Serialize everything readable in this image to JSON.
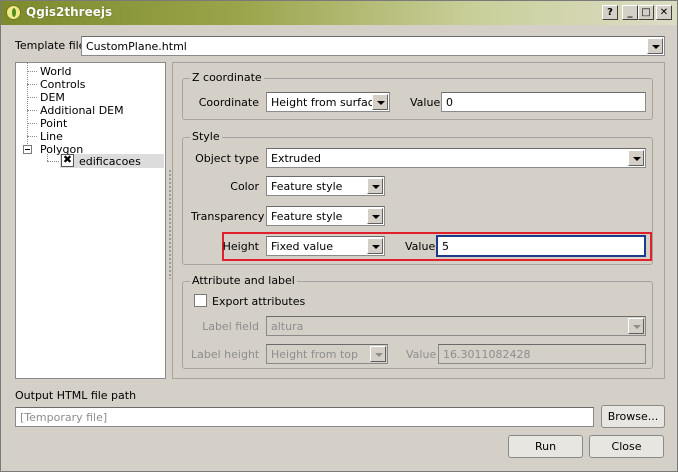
{
  "window": {
    "title": "Qgis2threejs"
  },
  "titlebar_buttons": {
    "help": "?",
    "minimize": "_",
    "maximize": "□",
    "close": "✕"
  },
  "template": {
    "label": "Template file",
    "value": "CustomPlane.html"
  },
  "tree": {
    "items": [
      "World",
      "Controls",
      "DEM",
      "Additional DEM",
      "Point",
      "Line",
      "Polygon"
    ],
    "layer": {
      "label": "edificacoes",
      "check": "✖"
    }
  },
  "z_coordinate": {
    "title": "Z coordinate",
    "coordinate_label": "Coordinate",
    "coordinate_value": "Height from surface",
    "value_label": "Value",
    "value": "0"
  },
  "style": {
    "title": "Style",
    "object_type_label": "Object type",
    "object_type_value": "Extruded",
    "color_label": "Color",
    "color_value": "Feature style",
    "transparency_label": "Transparency",
    "transparency_value": "Feature style",
    "height_label": "Height",
    "height_value": "Fixed value",
    "height_value_label": "Value",
    "height_number": "5"
  },
  "attribute_label": {
    "title": "Attribute and label",
    "export_label": "Export attributes",
    "label_field_label": "Label field",
    "label_field_value": "altura",
    "label_height_label": "Label height",
    "label_height_value": "Height from top",
    "value_label": "Value",
    "value": "16.3011082428"
  },
  "output": {
    "label": "Output HTML file path",
    "placeholder": "[Temporary file]",
    "browse": "Browse..."
  },
  "buttons": {
    "run": "Run",
    "close": "Close"
  },
  "colors": {
    "highlight": "#e0202a",
    "titlebar": "#7c8a2c",
    "focus_border": "#1e3a8a"
  }
}
